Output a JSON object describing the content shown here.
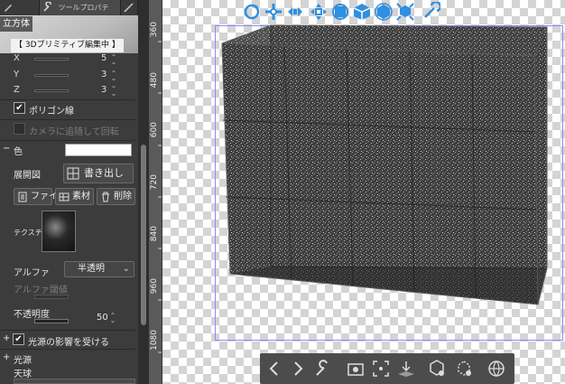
{
  "panel": {
    "tabs": [
      {
        "icon": "brush-icon",
        "label": ""
      },
      {
        "icon": "wrench-icon",
        "label": "ツールプロパテ"
      },
      {
        "icon": "pen-icon",
        "label": ""
      }
    ],
    "tool_name": "立方体",
    "mode_banner": "【 3Dプリミティブ編集中 】",
    "axes": [
      {
        "label": "X",
        "value": "5"
      },
      {
        "label": "Y",
        "value": "3"
      },
      {
        "label": "Z",
        "value": "3"
      }
    ],
    "polygon_lines": {
      "label": "ポリゴン線",
      "checked": true
    },
    "rotate_with_camera": {
      "label": "カメラに追随して回転",
      "checked": false
    },
    "color": {
      "toggle": "−",
      "label": "色",
      "swatch": "#ffffff"
    },
    "unfold": {
      "label": "展開図",
      "export_button": "書き出し"
    },
    "file_buttons": [
      {
        "icon": "file-icon",
        "label": "ファイ"
      },
      {
        "icon": "material-icon",
        "label": "素材"
      },
      {
        "icon": "trash-icon",
        "label": "削除"
      }
    ],
    "texture_label": "テクスチ",
    "alpha": {
      "label": "アルファ",
      "value": "半透明"
    },
    "alpha_threshold": {
      "label": "アルファ閾値"
    },
    "opacity": {
      "label": "不透明度",
      "value": "50"
    },
    "light_influence": {
      "toggle": "+",
      "label": "光源の影響を受ける",
      "checked": true
    },
    "light_source": {
      "toggle": "+",
      "label": "光源"
    },
    "sky": {
      "label": "天球"
    }
  },
  "ruler": {
    "labels": [
      "360",
      "480",
      "600",
      "720",
      "840",
      "960",
      "1080"
    ]
  },
  "canvas": {
    "top_toolbar_icons": [
      "rotate-camera-icon",
      "pan-camera-icon",
      "dolly-camera-icon",
      "move-object-icon",
      "rotate-object-icon",
      "cube-view-icon",
      "cube-rotate-icon",
      "cube-scale-icon",
      "reset-icon"
    ],
    "bottom_toolbar_icons": [
      "previous-icon",
      "next-icon",
      "wrench-icon",
      "camera-fit-icon",
      "frame-select-icon",
      "ground-icon",
      "object-settings-icon",
      "rotate-reset-icon",
      "globe-icon"
    ],
    "accent": "#2f8fe0"
  }
}
